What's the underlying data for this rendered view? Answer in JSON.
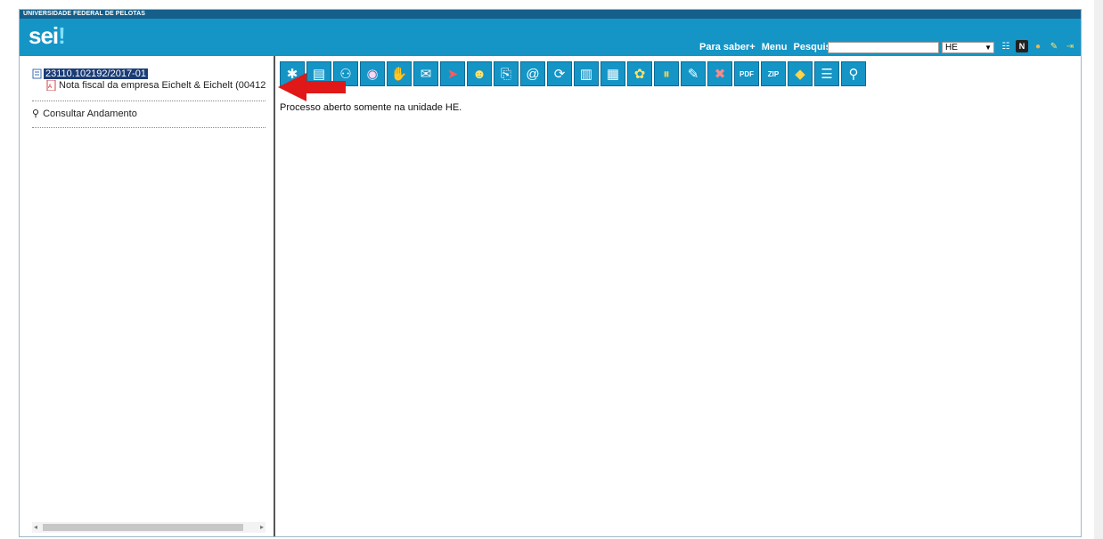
{
  "header": {
    "institution": "UNIVERSIDADE FEDERAL DE PELOTAS",
    "logo_text": "sei",
    "logo_dot": "!",
    "links": [
      "Para saber+",
      "Menu",
      "Pesquisa"
    ],
    "search_value": "",
    "unit_selected": "HE"
  },
  "tree": {
    "process_number": "23110.102192/2017-01",
    "document_label": "Nota fiscal da empresa Eichelt & Eichelt (00412",
    "consultar_label": "Consultar Andamento"
  },
  "main": {
    "message": "Processo aberto somente na unidade HE."
  },
  "toolbar_icons": [
    "new-document-icon",
    "new-process-icon",
    "people-icon",
    "eye-icon",
    "thumbs-up-icon",
    "envelope-icon",
    "send-icon",
    "assign-user-icon",
    "attach-icon",
    "email-icon",
    "refresh-icon",
    "books-icon",
    "building-icon",
    "tag-icon",
    "pause-icon",
    "edit-icon",
    "cancel-icon",
    "pdf-icon",
    "zip-icon",
    "label-icon",
    "list-icon",
    "search-icon"
  ],
  "colors": {
    "header_bg": "#1495c6",
    "top_strip": "#155f8a",
    "process_highlight": "#1b3c75",
    "annotation_arrow": "#e01818"
  }
}
